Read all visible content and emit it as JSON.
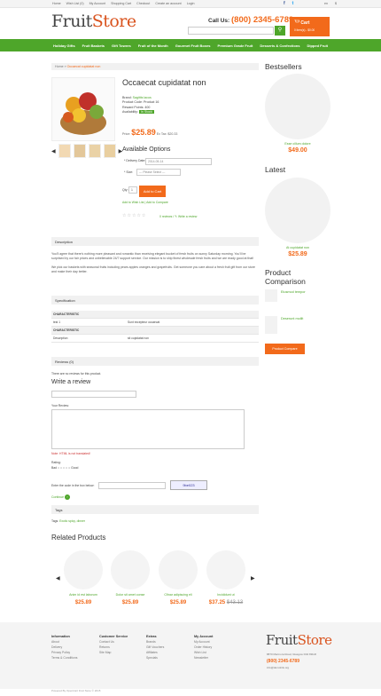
{
  "topbar": {
    "links": [
      "Home",
      "Wish List (0)",
      "My Account",
      "Shopping Cart",
      "Checkout",
      "Create an account",
      "Login"
    ],
    "lang": "en",
    "currency": "$"
  },
  "header": {
    "logo_a": "Fruit",
    "logo_b": "Store",
    "call_label": "Call Us:",
    "phone": "(800) 2345-6789",
    "cart_title": "Cart",
    "cart_sub": "0 item(s) - $0.00"
  },
  "nav": [
    "Holiday Gifts",
    "Fruit Baskets",
    "Gift Towers",
    "Fruit of the Month",
    "Gourmet Fruit Boxes",
    "Premium Grade Fruit",
    "Desserts & Confections",
    "Dipped Fruit"
  ],
  "breadcrumb": {
    "home": "Home",
    "sep": " » ",
    "current": "Occaecat cupidatat non"
  },
  "product": {
    "title": "Occaecat cupidatat non",
    "brand_label": "Brand:",
    "brand": "Sagittis lacus",
    "code_label": "Product Code:",
    "code": "Product 16",
    "points_label": "Reward Points:",
    "points": "400",
    "avail_label": "Availability:",
    "avail": "In Stock",
    "price_label": "Price:",
    "price": "$25.89",
    "extax": "Ex Tax: $20.33"
  },
  "options": {
    "title": "Available Options",
    "date_label": "* Delivery Date:",
    "date": "2014-05-14",
    "size_label": "* Size:",
    "size": " --- Please Select --- ",
    "qty_label": "Qty:",
    "qty": "1",
    "add": "Add to Cart",
    "wish": "Add to Wish List",
    "compare": "Add to Compare",
    "reviews": "0 reviews",
    "write": "Write a review"
  },
  "description": {
    "title": "Description",
    "p1": "You'll agree that there's nothing more pleasant and romantic than receiving elegant bucket of fresh fruits on sunny Saturday morning. You'll be surprised by our fair prices and unbelievable 24/7 support service. Our mission is to ship finest wholesale fresh fruits and we are ready good at that!",
    "p2": "We pick our baskets with seasonal fruits including pears apples oranges and grapefruits. Get someone you care about a fresh fruit gift from our store and make their day better."
  },
  "spec": {
    "title": "Specification",
    "rows": [
      {
        "a": "CHARACTERISTIC",
        "b": "",
        "hd": true
      },
      {
        "a": "test 1",
        "b": "Sunt excepteur occaecat",
        "hd": false
      },
      {
        "a": "CHARACTERISTIC",
        "b": "",
        "hd": true
      },
      {
        "a": "Description",
        "b": "sit cupidatat non",
        "hd": false
      }
    ]
  },
  "reviews": {
    "title": "Reviews (0)",
    "none": "There are no reviews for this product.",
    "write": "Write a review",
    "name_label": "Your Name:",
    "review_label": "Your Review:",
    "note": "Note: HTML is not translated!",
    "rating_label": "Rating:",
    "bad": "Bad",
    "good": "Good",
    "captcha_label": "Enter the code in the box below:",
    "captcha": "9be023",
    "continue": "Continue"
  },
  "tags": {
    "title": "Tags",
    "label": "Tags:",
    "value": "Exotic spicy, dinner"
  },
  "related": {
    "title": "Related Products",
    "items": [
      {
        "name": "Anim id est laborum",
        "price": "$25.89",
        "old": ""
      },
      {
        "name": "Dolor sit amet conse",
        "price": "$25.89",
        "old": ""
      },
      {
        "name": "Cfinar adipiscing eli",
        "price": "$25.89",
        "old": ""
      },
      {
        "name": "Incididunt ut",
        "price": "$37.25",
        "old": "$43.13"
      }
    ]
  },
  "sidebar": {
    "best_title": "Bestsellers",
    "best_name": "Esse cillum dolore",
    "best_price": "$49.00",
    "latest_title": "Latest",
    "latest_name": "At cupidatat non",
    "latest_price": "$25.89",
    "compare_title_a": "Product",
    "compare_title_b": "Comparison",
    "cmp1": "Eiusmod tempor",
    "cmp2": "Deserunt mollit",
    "cmp_btn": "Product Compare"
  },
  "footer": {
    "info": {
      "title": "Information",
      "items": [
        "About",
        "Delivery",
        "Privacy Policy",
        "Terms & Conditions"
      ]
    },
    "service": {
      "title": "Customer Service",
      "items": [
        "Contact Us",
        "Returns",
        "Site Map"
      ]
    },
    "extras": {
      "title": "Extras",
      "items": [
        "Brands",
        "Gift Vouchers",
        "Affiliates",
        "Specials"
      ]
    },
    "account": {
      "title": "My Account",
      "items": [
        "My Account",
        "Order History",
        "Wish List",
        "Newsletter"
      ]
    },
    "address": "8870 Marmora Road, Glasgow D04 89GR",
    "phone": "(800) 2345-6789",
    "email": "info@demolink.org",
    "copy": "Powered By OpenCart Fruit Store © 2015"
  },
  "colors": {
    "green": "#4ea62a",
    "orange": "#f26a1b"
  }
}
